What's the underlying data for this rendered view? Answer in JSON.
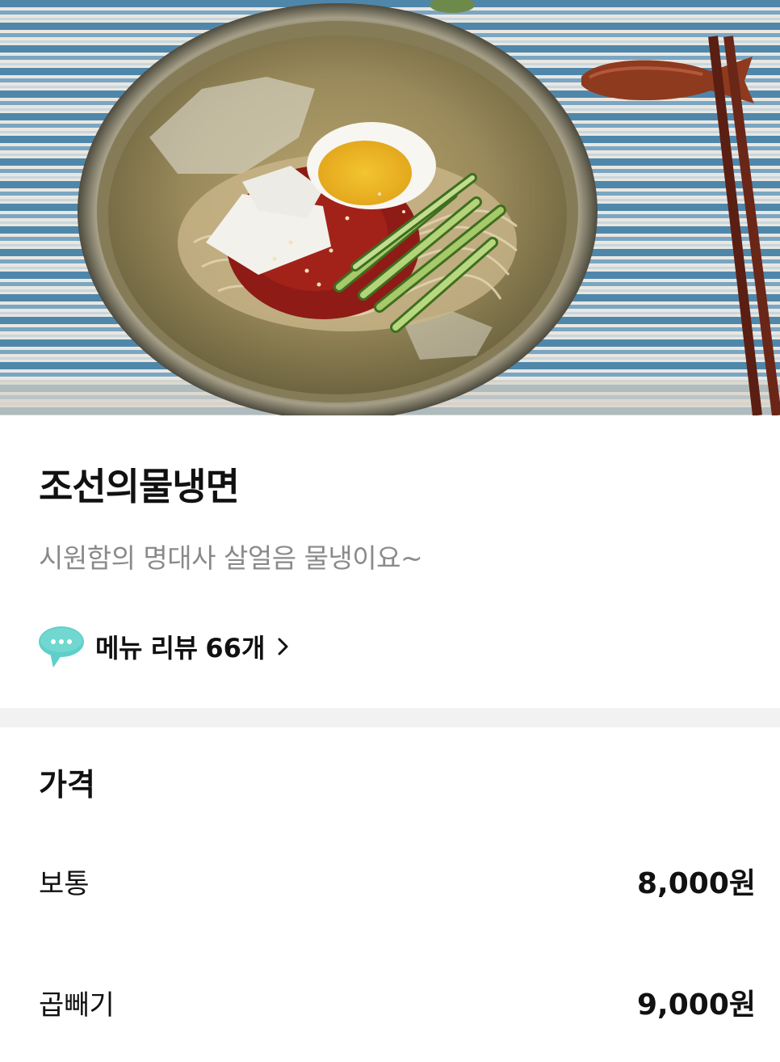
{
  "menu": {
    "name": "조선의물냉면",
    "description": "시원함의 명대사 살얼음 물냉이요~",
    "review": {
      "icon": "chat-bubble-icon",
      "label": "메뉴 리뷰",
      "count": "66개"
    }
  },
  "price": {
    "heading": "가격",
    "options": [
      {
        "label": "보통",
        "price": "8,000원"
      },
      {
        "label": "곱빼기",
        "price": "9,000원"
      }
    ]
  },
  "colors": {
    "review_icon": "#5fcfc9",
    "divider": "#f2f2f3",
    "description_text": "#8a8a8a"
  }
}
